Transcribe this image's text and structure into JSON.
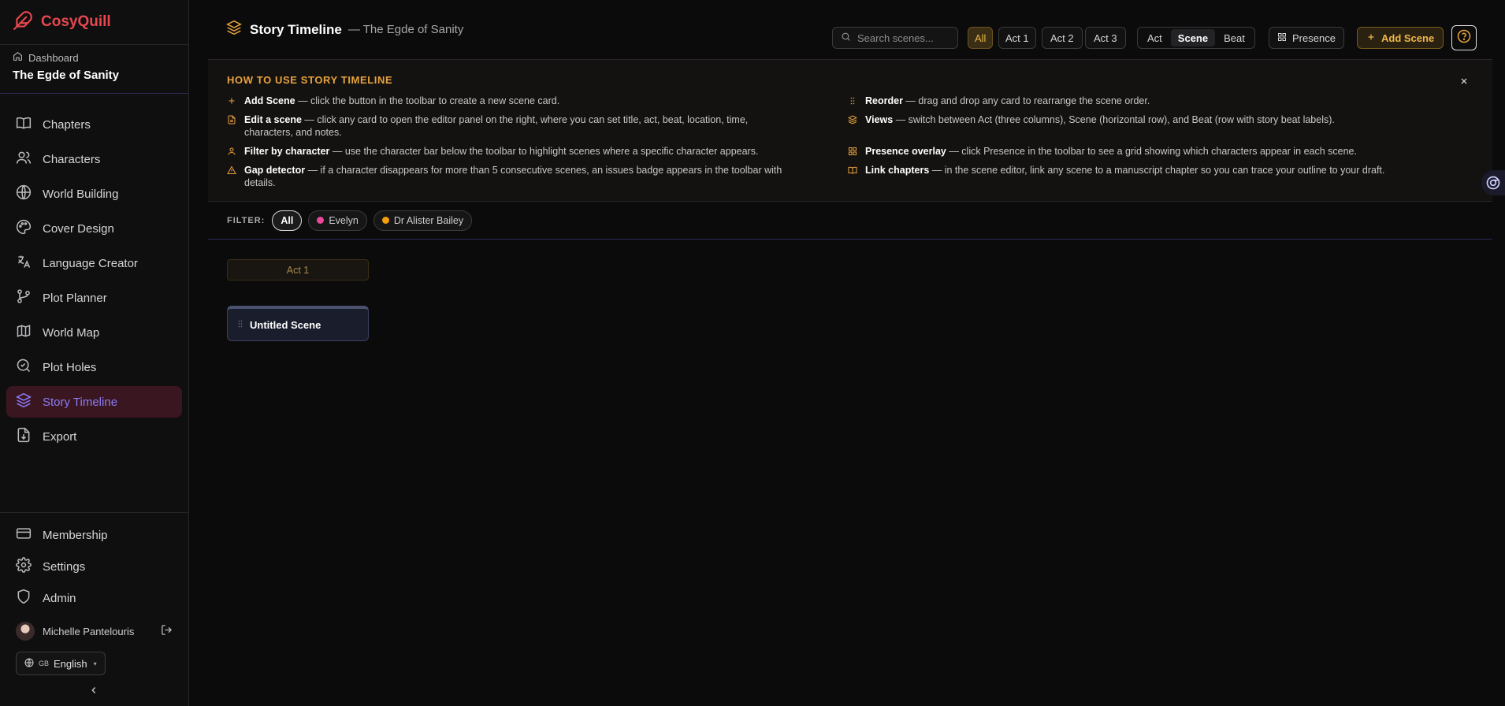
{
  "brand": {
    "name": "CosyQuill"
  },
  "project": {
    "breadcrumb": "Dashboard",
    "title": "The Egde of Sanity"
  },
  "sidebar": {
    "items": [
      {
        "label": "Chapters",
        "icon": "book-icon"
      },
      {
        "label": "Characters",
        "icon": "users-icon"
      },
      {
        "label": "World Building",
        "icon": "globe-icon"
      },
      {
        "label": "Cover Design",
        "icon": "palette-icon"
      },
      {
        "label": "Language Creator",
        "icon": "translate-icon"
      },
      {
        "label": "Plot Planner",
        "icon": "git-branch-icon"
      },
      {
        "label": "World Map",
        "icon": "map-icon"
      },
      {
        "label": "Plot Holes",
        "icon": "search-check-icon"
      },
      {
        "label": "Story Timeline",
        "icon": "layers-icon",
        "active": true
      },
      {
        "label": "Export",
        "icon": "file-export-icon"
      }
    ],
    "bottom": [
      {
        "label": "Membership",
        "icon": "credit-card-icon"
      },
      {
        "label": "Settings",
        "icon": "gear-icon"
      },
      {
        "label": "Admin",
        "icon": "shield-icon"
      }
    ],
    "user": "Michelle Pantelouris",
    "language": {
      "flag": "GB",
      "label": "English"
    }
  },
  "header": {
    "title": "Story Timeline",
    "subtitle": "— The Egde of Sanity",
    "search_placeholder": "Search scenes...",
    "act_filters": [
      "All",
      "Act 1",
      "Act 2",
      "Act 3"
    ],
    "act_filter_active": "All",
    "views": [
      "Act",
      "Scene",
      "Beat"
    ],
    "view_active": "Scene",
    "presence_label": "Presence",
    "add_scene_label": "Add Scene"
  },
  "howto": {
    "title": "HOW TO USE STORY TIMELINE",
    "tips": [
      {
        "icon": "plus-icon",
        "bold": "Add Scene",
        "text": " — click the button in the toolbar to create a new scene card."
      },
      {
        "icon": "grip-icon",
        "bold": "Reorder",
        "text": " — drag and drop any card to rearrange the scene order."
      },
      {
        "icon": "file-icon",
        "bold": "Edit a scene",
        "text": " — click any card to open the editor panel on the right, where you can set title, act, beat, location, time, characters, and notes."
      },
      {
        "icon": "layers-icon",
        "bold": "Views",
        "text": " — switch between Act (three columns), Scene (horizontal row), and Beat (row with story beat labels)."
      },
      {
        "icon": "user-icon",
        "bold": "Filter by character",
        "text": " — use the character bar below the toolbar to highlight scenes where a specific character appears."
      },
      {
        "icon": "grid-icon",
        "bold": "Presence overlay",
        "text": " — click Presence in the toolbar to see a grid showing which characters appear in each scene."
      },
      {
        "icon": "warning-icon",
        "bold": "Gap detector",
        "text": " — if a character disappears for more than 5 consecutive scenes, an issues badge appears in the toolbar with details."
      },
      {
        "icon": "book-open-icon",
        "bold": "Link chapters",
        "text": " — in the scene editor, link any scene to a manuscript chapter so you can trace your outline to your draft."
      }
    ]
  },
  "filter": {
    "label": "FILTER:",
    "chips": [
      {
        "label": "All",
        "active": true
      },
      {
        "label": "Evelyn",
        "color": "#ec4899"
      },
      {
        "label": "Dr Alister Bailey",
        "color": "#f59e0b"
      }
    ]
  },
  "board": {
    "act_label": "Act 1",
    "scenes": [
      {
        "title": "Untitled Scene"
      }
    ]
  },
  "colors": {
    "brand": "#e5484d",
    "accent": "#e8a33c",
    "active_nav_bg": "#3a1620",
    "active_nav_text": "#8b7cf6"
  }
}
